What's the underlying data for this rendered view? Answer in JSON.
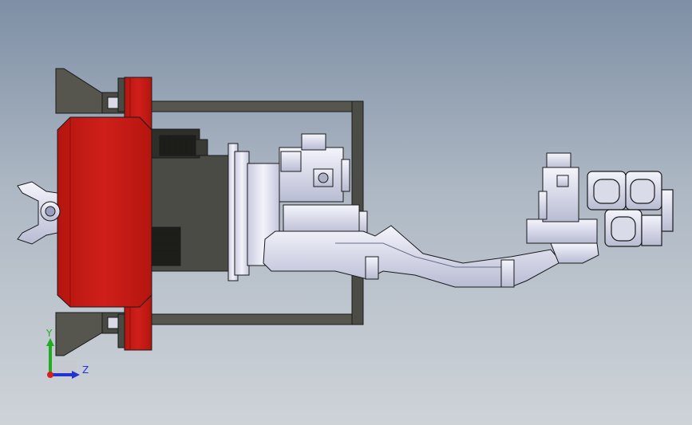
{
  "triad": {
    "y_label": "Y",
    "z_label": "Z",
    "y_color": "#1fae1f",
    "z_color": "#2233d6",
    "origin_color": "#d61f1f"
  },
  "colors": {
    "red_part": "#c41a17",
    "dark_gray": "#505049",
    "chrome": "#e6e8f2",
    "outline": "#1a1a1a"
  }
}
